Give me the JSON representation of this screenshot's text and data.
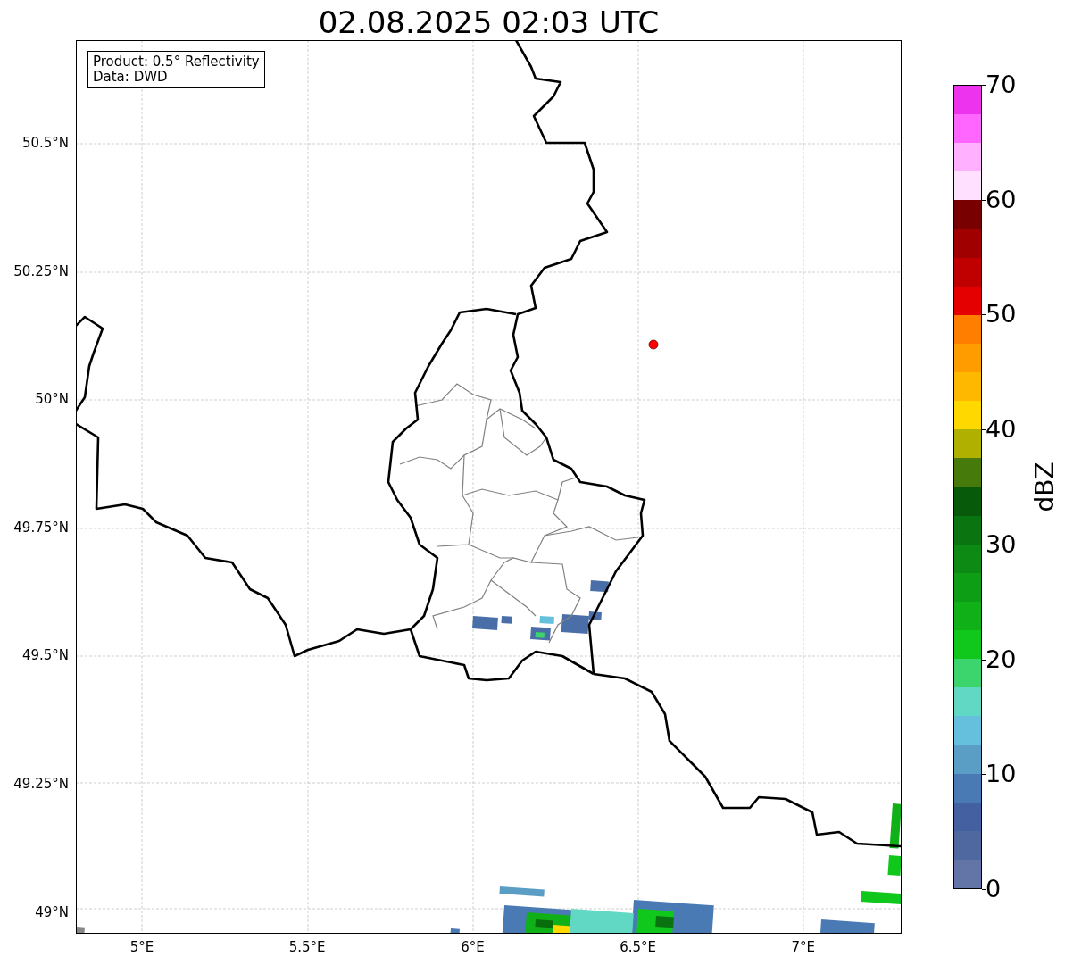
{
  "title": "02.08.2025 02:03 UTC",
  "info_box": {
    "lines": [
      "Product: 0.5° Reflectivity",
      "Data: DWD"
    ]
  },
  "map": {
    "lat_labels": [
      "50.5°N",
      "50.25°N",
      "50°N",
      "49.75°N",
      "49.5°N",
      "49.25°N",
      "49°N"
    ],
    "lon_labels": [
      "5°E",
      "5.5°E",
      "6°E",
      "6.5°E",
      "7°E"
    ]
  },
  "colorbar": {
    "label": "dBZ",
    "ticks": [
      "70",
      "60",
      "50",
      "40",
      "30",
      "20",
      "10",
      "0"
    ],
    "segments": [
      {
        "color": "#ee33ee"
      },
      {
        "color": "#ff66ff"
      },
      {
        "color": "#ffb0ff"
      },
      {
        "color": "#ffe0ff"
      },
      {
        "color": "#780000"
      },
      {
        "color": "#a00000"
      },
      {
        "color": "#c00000"
      },
      {
        "color": "#e40000"
      },
      {
        "color": "#ff7e00"
      },
      {
        "color": "#ff9c00"
      },
      {
        "color": "#ffb800"
      },
      {
        "color": "#ffd800"
      },
      {
        "color": "#b0b000"
      },
      {
        "color": "#467a0a"
      },
      {
        "color": "#065a0a"
      },
      {
        "color": "#0a7510"
      },
      {
        "color": "#0c8a14"
      },
      {
        "color": "#0e9e16"
      },
      {
        "color": "#10b018"
      },
      {
        "color": "#10c81c"
      },
      {
        "color": "#3cd46c"
      },
      {
        "color": "#60d8c4"
      },
      {
        "color": "#64c0dc"
      },
      {
        "color": "#5a9ec6"
      },
      {
        "color": "#4a7ab4"
      },
      {
        "color": "#4460a0"
      },
      {
        "color": "#5068a0"
      },
      {
        "color": "#6374a6"
      }
    ]
  }
}
